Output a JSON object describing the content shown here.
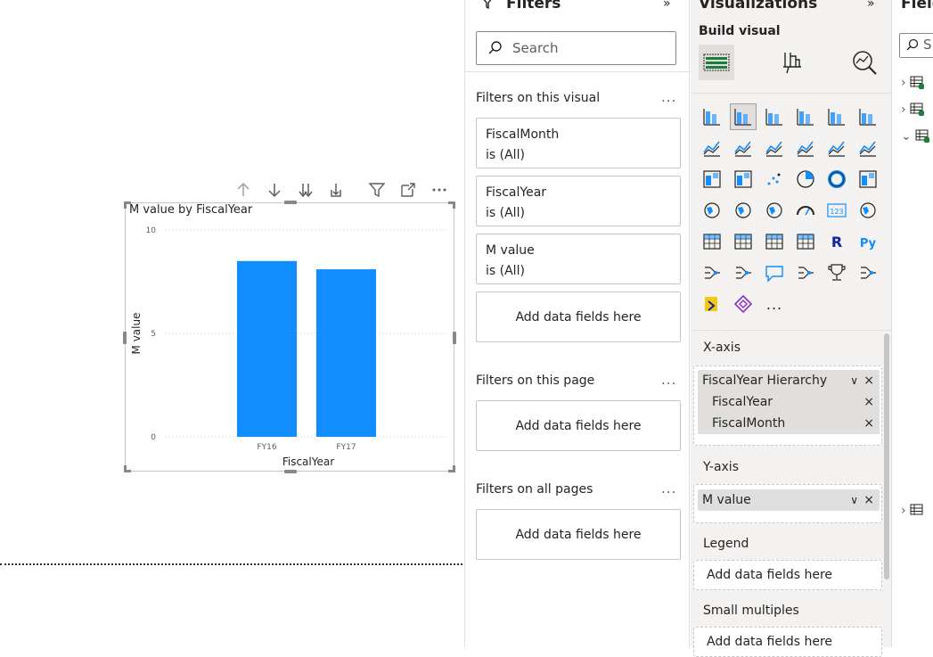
{
  "chart_data": {
    "type": "bar",
    "title": "M value by FiscalYear",
    "xlabel": "FiscalYear",
    "ylabel": "M value",
    "categories": [
      "FY16",
      "FY17"
    ],
    "values": [
      8.5,
      8.1
    ],
    "ylim": [
      0,
      10
    ],
    "yticks": [
      "0",
      "5",
      "10"
    ],
    "bar_color": "#118DFF",
    "grid": true,
    "legend": "none"
  },
  "filters": {
    "title": "Filters",
    "search_placeholder": "Search",
    "on_visual_label": "Filters on this visual",
    "cards": [
      {
        "field": "FiscalMonth",
        "state": "is (All)"
      },
      {
        "field": "FiscalYear",
        "state": "is (All)"
      },
      {
        "field": "M value",
        "state": "is (All)"
      }
    ],
    "add_fields": "Add data fields here",
    "on_page_label": "Filters on this page",
    "on_all_pages_label": "Filters on all pages",
    "more": "..."
  },
  "visualizations": {
    "title": "Visualizations",
    "build_visual": "Build visual",
    "more": "...",
    "xaxis_label": "X-axis",
    "xaxis_fields": {
      "hierarchy": "FiscalYear Hierarchy",
      "levels": [
        "FiscalYear",
        "FiscalMonth"
      ]
    },
    "yaxis_label": "Y-axis",
    "yaxis_field": "M value",
    "legend_label": "Legend",
    "legend_add": "Add data fields here",
    "small_multiples_label": "Small multiples",
    "small_multiples_add": "Add data fields here"
  },
  "fields": {
    "title": "Field",
    "search_placeholder": "S"
  },
  "icons": {
    "pill_close": "×",
    "pill_chevron": "∨"
  },
  "colors": {
    "accent": "#118DFF",
    "pane_bg": "#F3F2F1"
  }
}
